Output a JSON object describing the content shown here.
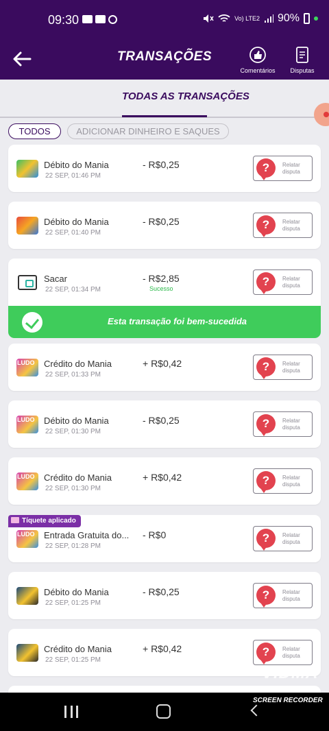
{
  "status_bar": {
    "time": "09:30",
    "network": "Vo) LTE2",
    "battery": "90%"
  },
  "header": {
    "title": "TRANSAÇÕES",
    "comments_label": "Comentários",
    "disputes_label": "Disputas"
  },
  "tabs": {
    "active": "TODAS AS TRANSAÇÕES"
  },
  "filters": {
    "all": "TODOS",
    "deposits_withdrawals": "ADICIONAR DINHEIRO E SAQUES"
  },
  "dispute_label": "Relatar disputa",
  "transactions": [
    {
      "name": "Débito do Mania",
      "date": "22 SEP, 01:46 PM",
      "amount": "- R$0,25",
      "thumb": "game-icon"
    },
    {
      "name": "Débito do Mania",
      "date": "22 SEP, 01:40 PM",
      "amount": "- R$0,25",
      "thumb": "game-icon"
    },
    {
      "name": "Sacar",
      "date": "22 SEP, 01:34 PM",
      "amount": "- R$2,85",
      "status": "Sucesso",
      "thumb": "wallet-icon"
    },
    {
      "name": "Crédito do Mania",
      "date": "22 SEP, 01:33 PM",
      "amount": "+ R$0,42",
      "thumb": "ludo-icon"
    },
    {
      "name": "Débito do Mania",
      "date": "22 SEP, 01:30 PM",
      "amount": "- R$0,25",
      "thumb": "ludo-icon"
    },
    {
      "name": "Crédito do Mania",
      "date": "22 SEP, 01:30 PM",
      "amount": "+ R$0,42",
      "thumb": "ludo-icon"
    },
    {
      "name": "Entrada Gratuita do...",
      "date": "22 SEP, 01:28 PM",
      "amount": "- R$0",
      "thumb": "ludo-icon",
      "badge": "Tíquete aplicado"
    },
    {
      "name": "Débito do Mania",
      "date": "22 SEP, 01:25 PM",
      "amount": "- R$0,25",
      "thumb": "game-icon"
    },
    {
      "name": "Crédito do Mania",
      "date": "22 SEP, 01:25 PM",
      "amount": "+ R$0,42",
      "thumb": "game-icon"
    }
  ],
  "success_banner": "Esta transação foi bem-sucedida",
  "overlay": {
    "watermark": "VIDMA",
    "recorder": "SCREEN RECORDER"
  },
  "colors": {
    "header": "#3a0b5e",
    "success": "#3fcc5b",
    "dispute": "#e2434f"
  }
}
